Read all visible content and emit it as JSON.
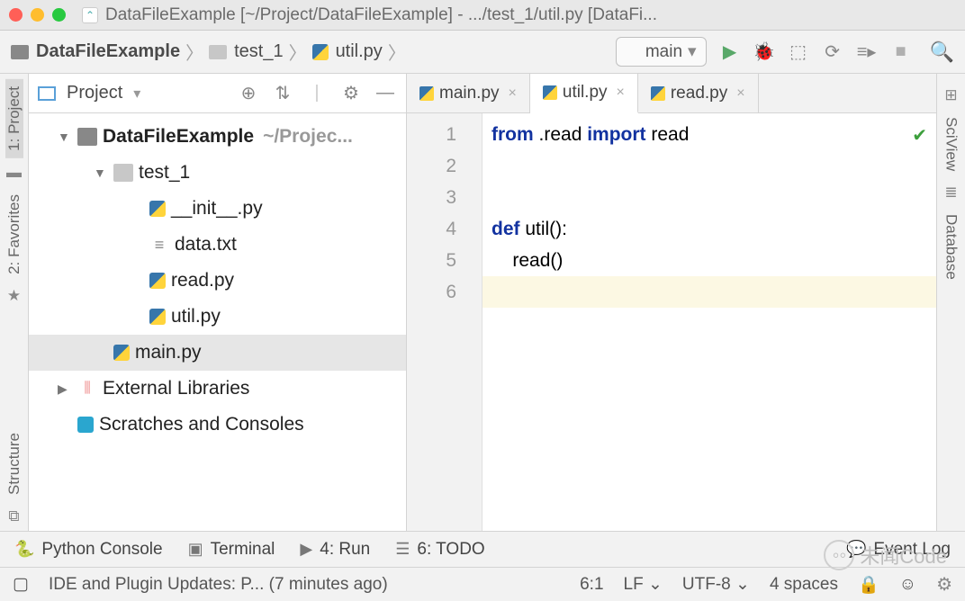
{
  "window": {
    "title": "DataFileExample [~/Project/DataFileExample] - .../test_1/util.py [DataFi..."
  },
  "breadcrumbs": {
    "p0": "DataFileExample",
    "p1": "test_1",
    "p2": "util.py"
  },
  "run": {
    "config": "main"
  },
  "projectPanel": {
    "title": "Project"
  },
  "tree": {
    "root": {
      "name": "DataFileExample",
      "path": "~/Projec..."
    },
    "pkg": "test_1",
    "f0": "__init__.py",
    "f1": "data.txt",
    "f2": "read.py",
    "f3": "util.py",
    "main": "main.py",
    "ext": "External Libraries",
    "scr": "Scratches and Consoles"
  },
  "leftStrip": {
    "l0": "1: Project",
    "l1": "2: Favorites",
    "l2": "Structure"
  },
  "rightStrip": {
    "r0": "SciView",
    "r1": "Database"
  },
  "tabs": {
    "t0": "main.py",
    "t1": "util.py",
    "t2": "read.py"
  },
  "editor": {
    "gutter": [
      "1",
      "2",
      "3",
      "4",
      "5",
      "6"
    ],
    "code_tokens": [
      [
        {
          "t": "from",
          "c": "kw"
        },
        {
          "t": " .read ",
          "c": ""
        },
        {
          "t": "import",
          "c": "kw"
        },
        {
          "t": " read",
          "c": ""
        }
      ],
      [],
      [],
      [
        {
          "t": "def",
          "c": "kw"
        },
        {
          "t": " util():",
          "c": ""
        }
      ],
      [
        {
          "t": "    read()",
          "c": ""
        }
      ],
      []
    ]
  },
  "bottomTools": {
    "b0": "Python Console",
    "b1": "Terminal",
    "b2": "4: Run",
    "b3": "6: TODO",
    "b4": "Event Log"
  },
  "status": {
    "msg": "IDE and Plugin Updates: P... (7 minutes ago)",
    "pos": "6:1",
    "eol": "LF",
    "enc": "UTF-8",
    "indent": "4 spaces"
  },
  "watermark": "未闻Code"
}
